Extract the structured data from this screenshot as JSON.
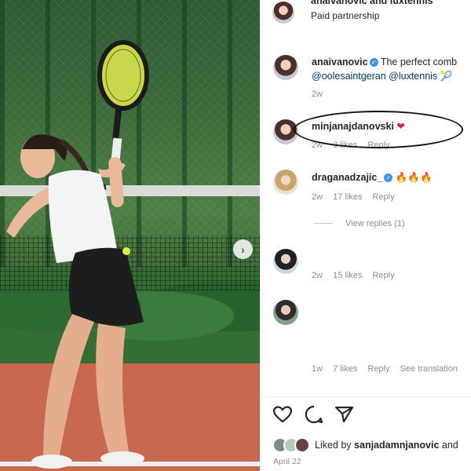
{
  "header": {
    "owner_text": "anaivanovic and luxtennis",
    "partnership": "Paid partnership"
  },
  "caption": {
    "username": "anaivanovic",
    "text": "The perfect comb",
    "mentions": "@oolesaintgeran @luxtennis",
    "time": "2w"
  },
  "comments": [
    {
      "username": "minjanajdanovski",
      "emoji": "❤",
      "time": "2w",
      "likes": "3 likes",
      "reply": "Reply"
    },
    {
      "username": "draganadzajic_",
      "emoji": "🔥🔥🔥",
      "time": "2w",
      "likes": "17 likes",
      "reply": "Reply",
      "view_replies": "View replies (1)"
    },
    {
      "username": "",
      "time": "2w",
      "likes": "15 likes",
      "reply": "Reply"
    },
    {
      "username": "",
      "time": "1w",
      "likes": "7 likes",
      "reply": "Reply",
      "translation": "See translation"
    }
  ],
  "footer": {
    "liked_by_prefix": "Liked by",
    "liked_by_user": "sanjadamnjanovic",
    "liked_by_suffix": "and",
    "date": "April 22"
  },
  "icons": {
    "like": "heart-icon",
    "comment": "comment-icon",
    "share": "share-icon",
    "next": "chevron-right-icon",
    "verified": "verified-badge-icon"
  },
  "colors": {
    "link": "#00376b",
    "verified": "#3897f0",
    "meta": "#8e8e8e",
    "heart": "#e0243a"
  }
}
